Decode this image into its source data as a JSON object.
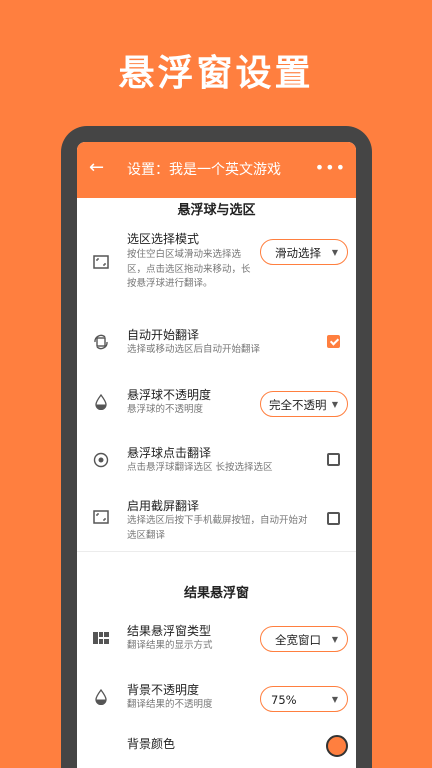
{
  "promo": {
    "title": "悬浮窗设置"
  },
  "appbar": {
    "back_icon": "arrow-left-icon",
    "title": "设置：我是一个英文游戏",
    "more_icon": "more-dots-icon"
  },
  "sections": {
    "float_ball": "悬浮球与选区",
    "result_window": "结果悬浮窗"
  },
  "rows": {
    "select_mode": {
      "label": "选区选择模式",
      "desc": "按住空白区域滑动来选择选区，点击选区拖动来移动，长按悬浮球进行翻译。",
      "value": "滑动选择"
    },
    "auto_translate": {
      "label": "自动开始翻译",
      "desc": "选择或移动选区后自动开始翻译",
      "checked": true
    },
    "ball_opacity": {
      "label": "悬浮球不透明度",
      "desc": "悬浮球的不透明度",
      "value": "完全不透明"
    },
    "tap_translate": {
      "label": "悬浮球点击翻译",
      "desc": "点击悬浮球翻译选区 长按选择选区",
      "checked": false
    },
    "screenshot_translate": {
      "label": "启用截屏翻译",
      "desc": "选择选区后按下手机截屏按钮，自动开始对选区翻译",
      "checked": false
    },
    "result_type": {
      "label": "结果悬浮窗类型",
      "desc": "翻译结果的显示方式",
      "value": "全宽窗口"
    },
    "bg_opacity": {
      "label": "背景不透明度",
      "desc": "翻译结果的不透明度",
      "value": "75%"
    },
    "bg_color": {
      "label": "背景颜色"
    }
  },
  "colors": {
    "accent": "#FF7F3F",
    "phone_frame": "#454545"
  }
}
